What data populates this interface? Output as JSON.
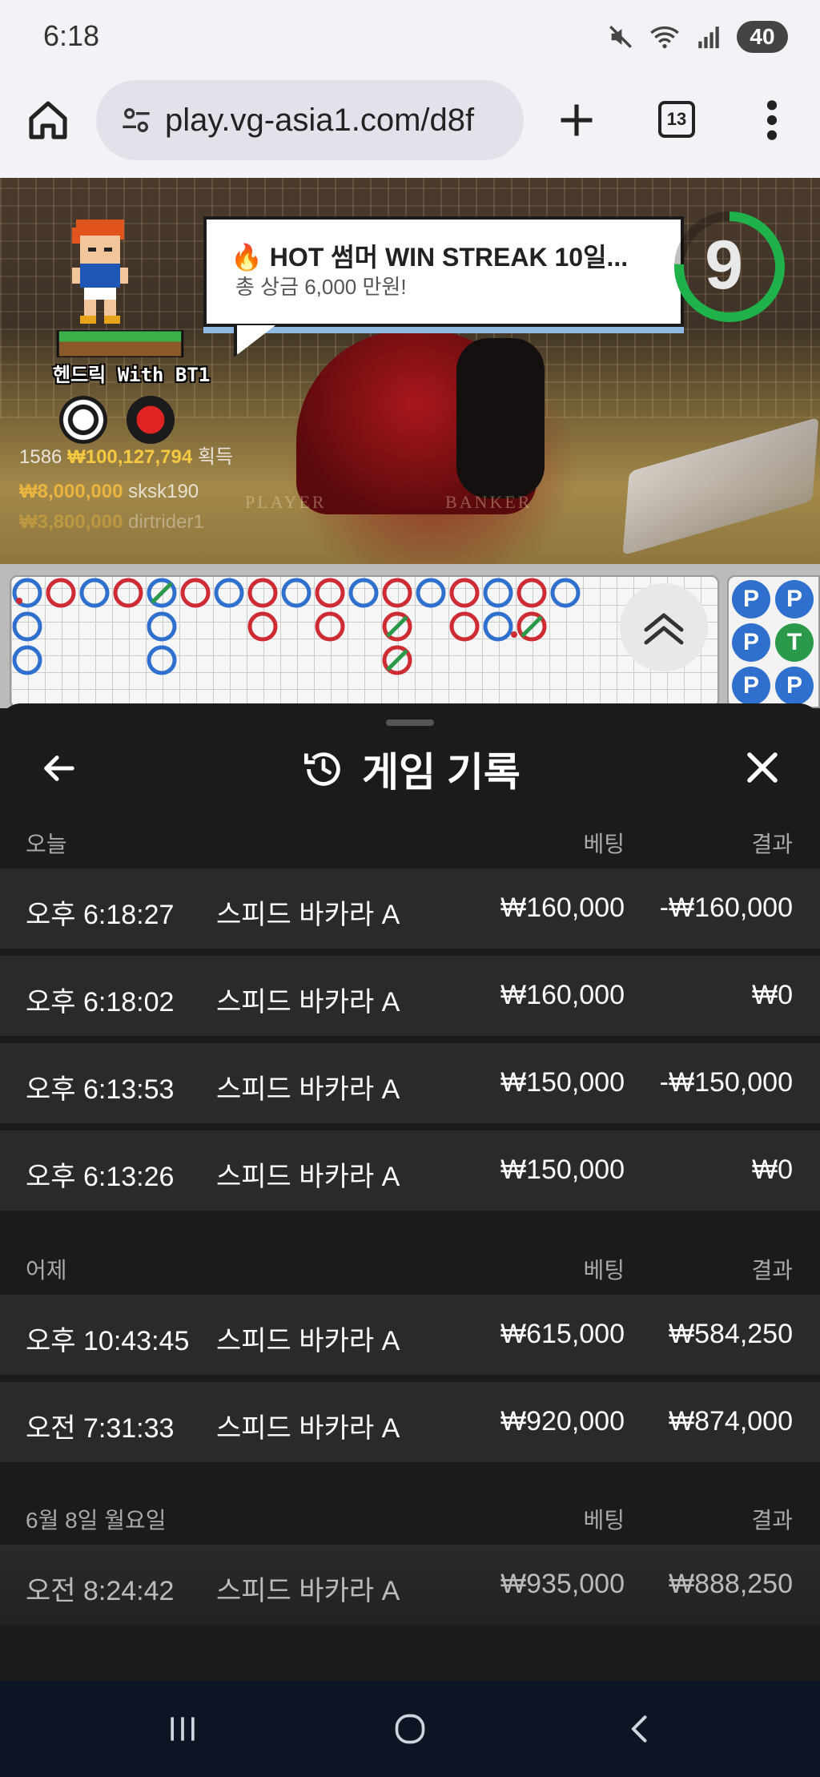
{
  "status": {
    "time": "6:18",
    "battery": "40"
  },
  "browser": {
    "url": "play.vg-asia1.com/d8f",
    "tab_count": "13"
  },
  "game": {
    "promo_title": "🔥 HOT 썸머 WIN STREAK 10일...",
    "promo_subtitle": "총 상금 6,000 만원!",
    "timer": "9",
    "mascot_name": "헨드릭 With BT1",
    "wins": [
      {
        "count": "1586",
        "amount": "₩100,127,794",
        "suffix": "획득"
      },
      {
        "amount": "₩8,000,000",
        "nick": "sksk190"
      },
      {
        "amount": "₩3,800,000",
        "nick": "dirtrider1"
      }
    ],
    "table_labels": {
      "player": "PLAYER",
      "banker": "BANKER"
    }
  },
  "bead_road": [
    "P",
    "P",
    "P",
    "T",
    "P",
    "P"
  ],
  "history": {
    "title": "게임 기록",
    "sections": [
      {
        "label": "오늘",
        "bet_header": "베팅",
        "result_header": "결과",
        "rows": [
          {
            "time": "오후 6:18:27",
            "game": "스피드 바카라 A",
            "bet": "₩160,000",
            "result": "-₩160,000"
          },
          {
            "time": "오후 6:18:02",
            "game": "스피드 바카라 A",
            "bet": "₩160,000",
            "result": "₩0"
          },
          {
            "time": "오후 6:13:53",
            "game": "스피드 바카라 A",
            "bet": "₩150,000",
            "result": "-₩150,000"
          },
          {
            "time": "오후 6:13:26",
            "game": "스피드 바카라 A",
            "bet": "₩150,000",
            "result": "₩0"
          }
        ]
      },
      {
        "label": "어제",
        "bet_header": "베팅",
        "result_header": "결과",
        "rows": [
          {
            "time": "오후 10:43:45",
            "game": "스피드 바카라 A",
            "bet": "₩615,000",
            "result": "₩584,250"
          },
          {
            "time": "오전 7:31:33",
            "game": "스피드 바카라 A",
            "bet": "₩920,000",
            "result": "₩874,000"
          }
        ]
      },
      {
        "label": "6월 8일 월요일",
        "bet_header": "베팅",
        "result_header": "결과",
        "rows": [
          {
            "time": "오전 8:24:42",
            "game": "스피드 바카라 A",
            "bet": "₩935,000",
            "result": "₩888,250"
          }
        ]
      }
    ]
  },
  "colors": {
    "player": "#2f6fce",
    "banker": "#cf2b32",
    "tie": "#2a9a4a",
    "sheet_bg": "#1b1b1b",
    "row_bg": "#2a2a2a"
  }
}
